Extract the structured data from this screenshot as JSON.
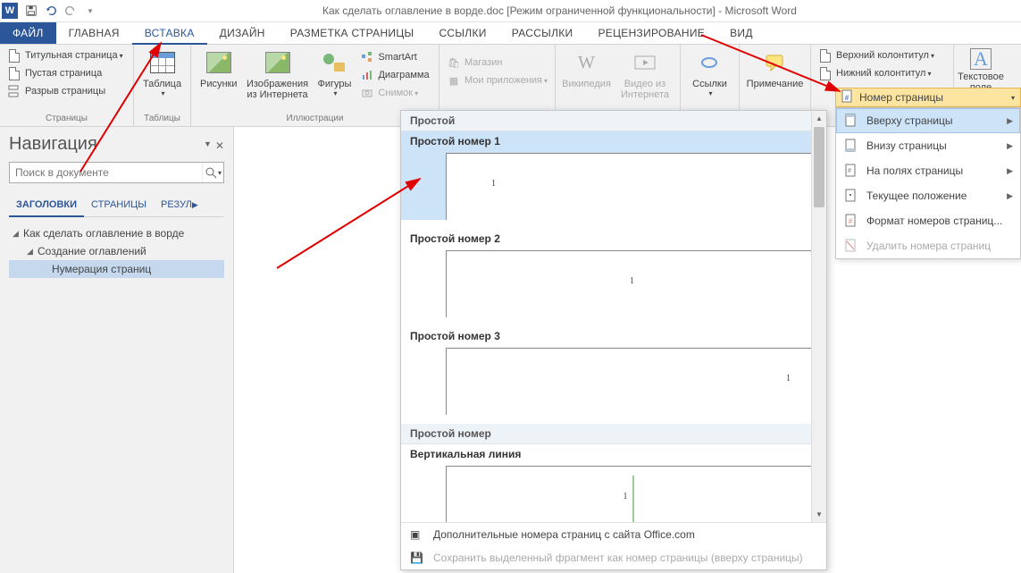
{
  "titlebar": {
    "title": "Как сделать оглавление в ворде.doc [Режим ограниченной функциональности] - Microsoft Word"
  },
  "tabs": {
    "file": "ФАЙЛ",
    "items": [
      "ГЛАВНАЯ",
      "ВСТАВКА",
      "ДИЗАЙН",
      "РАЗМЕТКА СТРАНИЦЫ",
      "ССЫЛКИ",
      "РАССЫЛКИ",
      "РЕЦЕНЗИРОВАНИЕ",
      "ВИД"
    ],
    "active_index": 1
  },
  "ribbon": {
    "pages": {
      "cover": "Титульная страница",
      "blank": "Пустая страница",
      "break": "Разрыв страницы",
      "group": "Страницы"
    },
    "tables": {
      "btn": "Таблица",
      "group": "Таблицы"
    },
    "illus": {
      "pictures": "Рисунки",
      "online": "Изображения из Интернета",
      "shapes": "Фигуры",
      "smartart": "SmartArt",
      "chart": "Диаграмма",
      "screenshot": "Снимок",
      "group": "Иллюстрации"
    },
    "apps": {
      "store": "Магазин",
      "myapps": "Мои приложения"
    },
    "media": {
      "wiki": "Википедия",
      "video": "Видео из Интернета"
    },
    "links": {
      "links": "Ссылки",
      "comment": "Примечание"
    },
    "header_footer": {
      "header": "Верхний колонтитул",
      "footer": "Нижний колонтитул",
      "pagenum": "Номер страницы"
    },
    "text": {
      "textbox": "Текстовое поле"
    }
  },
  "pn_menu": {
    "top": "Вверху страницы",
    "bottom": "Внизу страницы",
    "margins": "На полях страницы",
    "current": "Текущее положение",
    "format": "Формат номеров страниц...",
    "remove": "Удалить номера страниц"
  },
  "gallery": {
    "section1": "Простой",
    "item1": "Простой номер 1",
    "item2": "Простой номер 2",
    "item3": "Простой номер 3",
    "section2": "Простой номер",
    "item4": "Вертикальная линия",
    "sample_num": "1",
    "more": "Дополнительные номера страниц с сайта Office.com",
    "save_sel": "Сохранить выделенный фрагмент как номер страницы (вверху страницы)"
  },
  "nav": {
    "title": "Навигация",
    "search_placeholder": "Поиск в документе",
    "tabs": {
      "headings": "ЗАГОЛОВКИ",
      "pages": "СТРАНИЦЫ",
      "results": "РЕЗУЛ"
    },
    "tree": {
      "l1": "Как сделать оглавление в ворде",
      "l2": "Создание оглавлений",
      "l3": "Нумерация страниц"
    }
  }
}
